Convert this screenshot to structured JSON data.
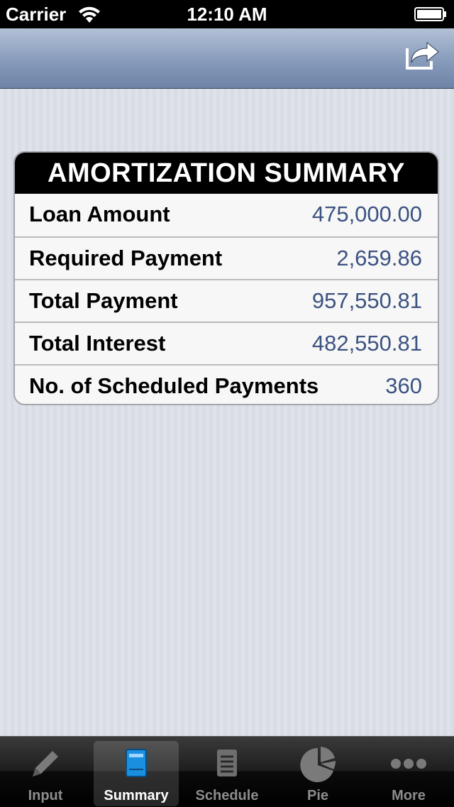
{
  "status_bar": {
    "carrier": "Carrier",
    "time": "12:10 AM"
  },
  "nav_bar": {
    "share_icon": "share-icon"
  },
  "summary": {
    "title": "AMORTIZATION SUMMARY",
    "rows": [
      {
        "label": "Loan Amount",
        "value": "475,000.00"
      },
      {
        "label": "Required Payment",
        "value": "2,659.86"
      },
      {
        "label": "Total Payment",
        "value": "957,550.81"
      },
      {
        "label": "Total Interest",
        "value": "482,550.81"
      },
      {
        "label": "No. of Scheduled Payments",
        "value": "360"
      }
    ]
  },
  "tab_bar": {
    "selected": "Summary",
    "tabs": [
      {
        "label": "Input",
        "icon": "pencil-icon"
      },
      {
        "label": "Summary",
        "icon": "document-icon"
      },
      {
        "label": "Schedule",
        "icon": "list-icon"
      },
      {
        "label": "Pie",
        "icon": "pie-chart-icon"
      },
      {
        "label": "More",
        "icon": "more-icon"
      }
    ]
  },
  "colors": {
    "value_text": "#3b5281",
    "nav_bar": "#8a9ebd",
    "selected_tab_icon": "#1a8fe0"
  }
}
